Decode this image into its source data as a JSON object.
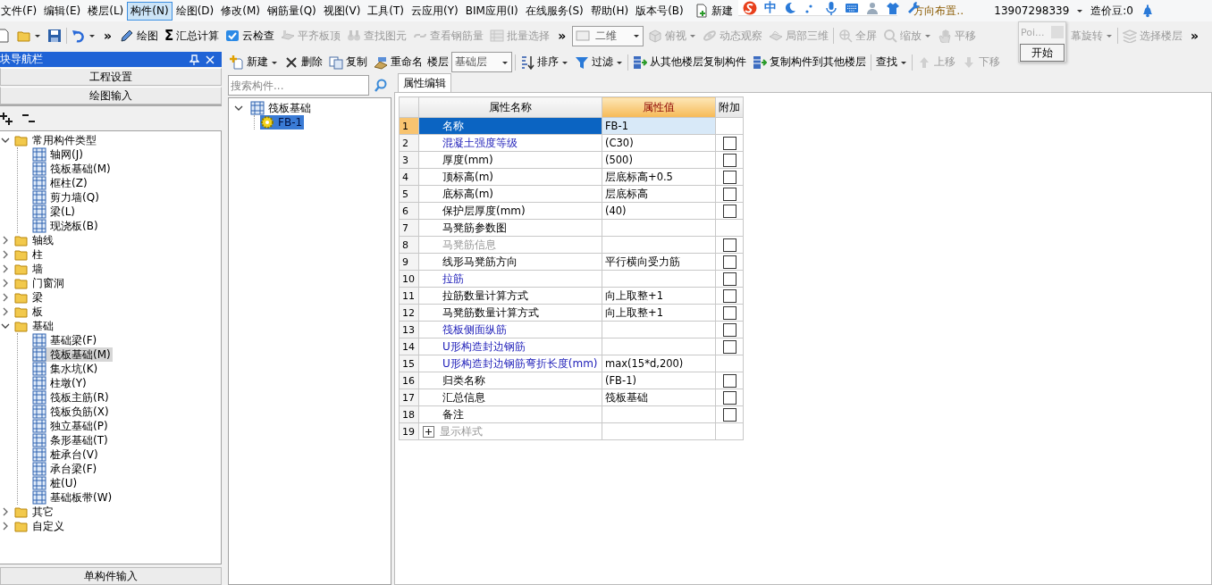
{
  "menu": [
    {
      "label": "文件(F)",
      "selected": false
    },
    {
      "label": "编辑(E)",
      "selected": false
    },
    {
      "label": "楼层(L)",
      "selected": false
    },
    {
      "label": "构件(N)",
      "selected": true
    },
    {
      "label": "绘图(D)",
      "selected": false
    },
    {
      "label": "修改(M)",
      "selected": false
    },
    {
      "label": "钢筋量(Q)",
      "selected": false
    },
    {
      "label": "视图(V)",
      "selected": false
    },
    {
      "label": "工具(T)",
      "selected": false
    },
    {
      "label": "云应用(Y)",
      "selected": false
    },
    {
      "label": "BIM应用(I)",
      "selected": false
    },
    {
      "label": "在线服务(S)",
      "selected": false
    },
    {
      "label": "帮助(H)",
      "selected": false
    },
    {
      "label": "版本号(B)",
      "selected": false
    }
  ],
  "title_area": {
    "new_label": "新建",
    "cut_label": "方向布置‥",
    "account": "13907298339",
    "beans": "造价豆:0"
  },
  "ime_bar": {
    "mode": "中"
  },
  "popup": {
    "field": "Poi...",
    "button": "开始"
  },
  "main_toolbar": [
    {
      "kind": "icon-button"
    },
    {
      "kind": "icon-button",
      "dropdown": true
    },
    {
      "kind": "icon-button"
    },
    {
      "kind": "separator"
    },
    {
      "kind": "icon-button",
      "dropdown": true
    },
    {
      "kind": "more",
      "label": "»"
    },
    {
      "kind": "button",
      "label": "绘图",
      "disabled": false
    },
    {
      "kind": "button",
      "glyph": "Σ",
      "label": "汇总计算",
      "disabled": false
    },
    {
      "kind": "button",
      "label": "云检查",
      "disabled": false
    },
    {
      "kind": "button",
      "label": "平齐板顶",
      "disabled": true
    },
    {
      "kind": "button",
      "label": "查找图元",
      "disabled": true
    },
    {
      "kind": "button",
      "label": "查看钢筋量",
      "disabled": true
    },
    {
      "kind": "button",
      "label": "批量选择",
      "disabled": true
    },
    {
      "kind": "more",
      "label": "»"
    },
    {
      "kind": "select",
      "value": "二维"
    },
    {
      "kind": "button",
      "label": "俯视",
      "disabled": true,
      "dropdown": true
    },
    {
      "kind": "button",
      "label": "动态观察",
      "disabled": true
    },
    {
      "kind": "button",
      "label": "局部三维",
      "disabled": true
    },
    {
      "kind": "separator"
    },
    {
      "kind": "button",
      "label": "全屏",
      "disabled": true
    },
    {
      "kind": "button",
      "label": "缩放",
      "disabled": true,
      "dropdown": true
    },
    {
      "kind": "button",
      "label": "平移",
      "disabled": true
    },
    {
      "kind": "button",
      "label": "幕旋转",
      "disabled": true,
      "dropdown": true
    },
    {
      "kind": "separator"
    },
    {
      "kind": "button",
      "label": "选择楼层",
      "disabled": true
    },
    {
      "kind": "more",
      "label": "»"
    }
  ],
  "list_toolbar": [
    {
      "kind": "button",
      "label": "新建",
      "disabled": false,
      "dropdown": true
    },
    {
      "kind": "button",
      "label": "删除",
      "disabled": false
    },
    {
      "kind": "button",
      "label": "复制",
      "disabled": false
    },
    {
      "kind": "button",
      "label": "重命名",
      "disabled": false
    },
    {
      "kind": "label",
      "label": "楼层"
    },
    {
      "kind": "select",
      "value": "基础层"
    },
    {
      "kind": "separator"
    },
    {
      "kind": "button",
      "label": "排序",
      "disabled": false,
      "dropdown": true
    },
    {
      "kind": "button",
      "label": "过滤",
      "disabled": false,
      "dropdown": true
    },
    {
      "kind": "separator"
    },
    {
      "kind": "button",
      "label": "从其他楼层复制构件",
      "disabled": false
    },
    {
      "kind": "button",
      "label": "复制构件到其他楼层",
      "disabled": false
    },
    {
      "kind": "separator"
    },
    {
      "kind": "button",
      "label": "查找",
      "disabled": false,
      "dropdown": true
    },
    {
      "kind": "separator"
    },
    {
      "kind": "button",
      "label": "上移",
      "disabled": true
    },
    {
      "kind": "button",
      "label": "下移",
      "disabled": true
    }
  ],
  "nav": {
    "title": "块导航栏",
    "sections": [
      "工程设置",
      "绘图输入"
    ],
    "footer": "单构件输入",
    "tree": [
      {
        "label": "常用构件类型",
        "kind": "folder",
        "expanded": true,
        "selected": false,
        "children": [
          {
            "label": "轴网(J)",
            "kind": "component",
            "selected": false
          },
          {
            "label": "筏板基础(M)",
            "kind": "component",
            "selected": false
          },
          {
            "label": "框柱(Z)",
            "kind": "component",
            "selected": false
          },
          {
            "label": "剪力墙(Q)",
            "kind": "component",
            "selected": false
          },
          {
            "label": "梁(L)",
            "kind": "component",
            "selected": false
          },
          {
            "label": "现浇板(B)",
            "kind": "component",
            "selected": false
          }
        ]
      },
      {
        "label": "轴线",
        "kind": "folder",
        "expanded": false,
        "selected": false
      },
      {
        "label": "柱",
        "kind": "folder",
        "expanded": false,
        "selected": false
      },
      {
        "label": "墙",
        "kind": "folder",
        "expanded": false,
        "selected": false
      },
      {
        "label": "门窗洞",
        "kind": "folder",
        "expanded": false,
        "selected": false
      },
      {
        "label": "梁",
        "kind": "folder",
        "expanded": false,
        "selected": false
      },
      {
        "label": "板",
        "kind": "folder",
        "expanded": false,
        "selected": false
      },
      {
        "label": "基础",
        "kind": "folder",
        "expanded": true,
        "selected": false,
        "children": [
          {
            "label": "基础梁(F)",
            "kind": "component",
            "selected": false
          },
          {
            "label": "筏板基础(M)",
            "kind": "component",
            "selected": true
          },
          {
            "label": "集水坑(K)",
            "kind": "component",
            "selected": false
          },
          {
            "label": "柱墩(Y)",
            "kind": "component",
            "selected": false
          },
          {
            "label": "筏板主筋(R)",
            "kind": "component",
            "selected": false
          },
          {
            "label": "筏板负筋(X)",
            "kind": "component",
            "selected": false
          },
          {
            "label": "独立基础(P)",
            "kind": "component",
            "selected": false
          },
          {
            "label": "条形基础(T)",
            "kind": "component",
            "selected": false
          },
          {
            "label": "桩承台(V)",
            "kind": "component",
            "selected": false
          },
          {
            "label": "承台梁(F)",
            "kind": "component",
            "selected": false
          },
          {
            "label": "桩(U)",
            "kind": "component",
            "selected": false
          },
          {
            "label": "基础板带(W)",
            "kind": "component",
            "selected": false
          }
        ]
      },
      {
        "label": "其它",
        "kind": "folder",
        "expanded": false,
        "selected": false
      },
      {
        "label": "自定义",
        "kind": "folder",
        "expanded": false,
        "selected": false
      }
    ]
  },
  "components": {
    "search": {
      "placeholder": "搜索构件..."
    },
    "tree": [
      {
        "label": "筏板基础",
        "kind": "group",
        "expanded": true,
        "selected": false,
        "children": [
          {
            "label": "FB-1",
            "kind": "item",
            "selected": true
          }
        ]
      }
    ]
  },
  "properties": {
    "tab": {
      "label": "属性编辑",
      "selected": true
    },
    "columns": [
      {
        "label": "属性名称",
        "selected": false
      },
      {
        "label": "属性值",
        "selected": true
      },
      {
        "label": "附加",
        "selected": false
      }
    ],
    "rows": [
      {
        "num": "1",
        "name": "名称",
        "value": "FB-1",
        "kind": "private",
        "selected": true
      },
      {
        "num": "2",
        "name": "混凝土强度等级",
        "value": "(C30)",
        "kind": "public",
        "selected": false,
        "addon": {
          "checked": false
        }
      },
      {
        "num": "3",
        "name": "厚度(mm)",
        "value": "(500)",
        "kind": "private",
        "selected": false,
        "addon": {
          "checked": false
        }
      },
      {
        "num": "4",
        "name": "顶标高(m)",
        "value": "层底标高+0.5",
        "kind": "private",
        "selected": false,
        "addon": {
          "checked": false
        }
      },
      {
        "num": "5",
        "name": "底标高(m)",
        "value": "层底标高",
        "kind": "private",
        "selected": false,
        "addon": {
          "checked": false
        }
      },
      {
        "num": "6",
        "name": "保护层厚度(mm)",
        "value": "(40)",
        "kind": "private",
        "selected": false,
        "addon": {
          "checked": false
        }
      },
      {
        "num": "7",
        "name": "马凳筋参数图",
        "kind": "private",
        "selected": false
      },
      {
        "num": "8",
        "name": "马凳筋信息",
        "kind": "unavailable",
        "selected": false,
        "addon": {
          "checked": false
        }
      },
      {
        "num": "9",
        "name": "线形马凳筋方向",
        "value": "平行横向受力筋",
        "kind": "private",
        "selected": false,
        "addon": {
          "checked": false
        }
      },
      {
        "num": "10",
        "name": "拉筋",
        "kind": "public",
        "selected": false,
        "addon": {
          "checked": false
        }
      },
      {
        "num": "11",
        "name": "拉筋数量计算方式",
        "value": "向上取整+1",
        "kind": "private",
        "selected": false,
        "addon": {
          "checked": false
        }
      },
      {
        "num": "12",
        "name": "马凳筋数量计算方式",
        "value": "向上取整+1",
        "kind": "private",
        "selected": false,
        "addon": {
          "checked": false
        }
      },
      {
        "num": "13",
        "name": "筏板侧面纵筋",
        "kind": "public",
        "selected": false,
        "addon": {
          "checked": false
        }
      },
      {
        "num": "14",
        "name": "U形构造封边钢筋",
        "kind": "public",
        "selected": false,
        "addon": {
          "checked": false
        }
      },
      {
        "num": "15",
        "name": "U形构造封边钢筋弯折长度(mm)",
        "value": "max(15*d,200)",
        "kind": "public",
        "selected": false
      },
      {
        "num": "16",
        "name": "归类名称",
        "value": "(FB-1)",
        "kind": "private",
        "selected": false,
        "addon": {
          "checked": false
        }
      },
      {
        "num": "17",
        "name": "汇总信息",
        "value": "筏板基础",
        "kind": "private",
        "selected": false,
        "addon": {
          "checked": false
        }
      },
      {
        "num": "18",
        "name": "备注",
        "kind": "private",
        "selected": false,
        "addon": {
          "checked": false
        }
      },
      {
        "num": "19",
        "name": "显示样式",
        "kind": "group",
        "expanded": false,
        "selected": false
      }
    ]
  }
}
